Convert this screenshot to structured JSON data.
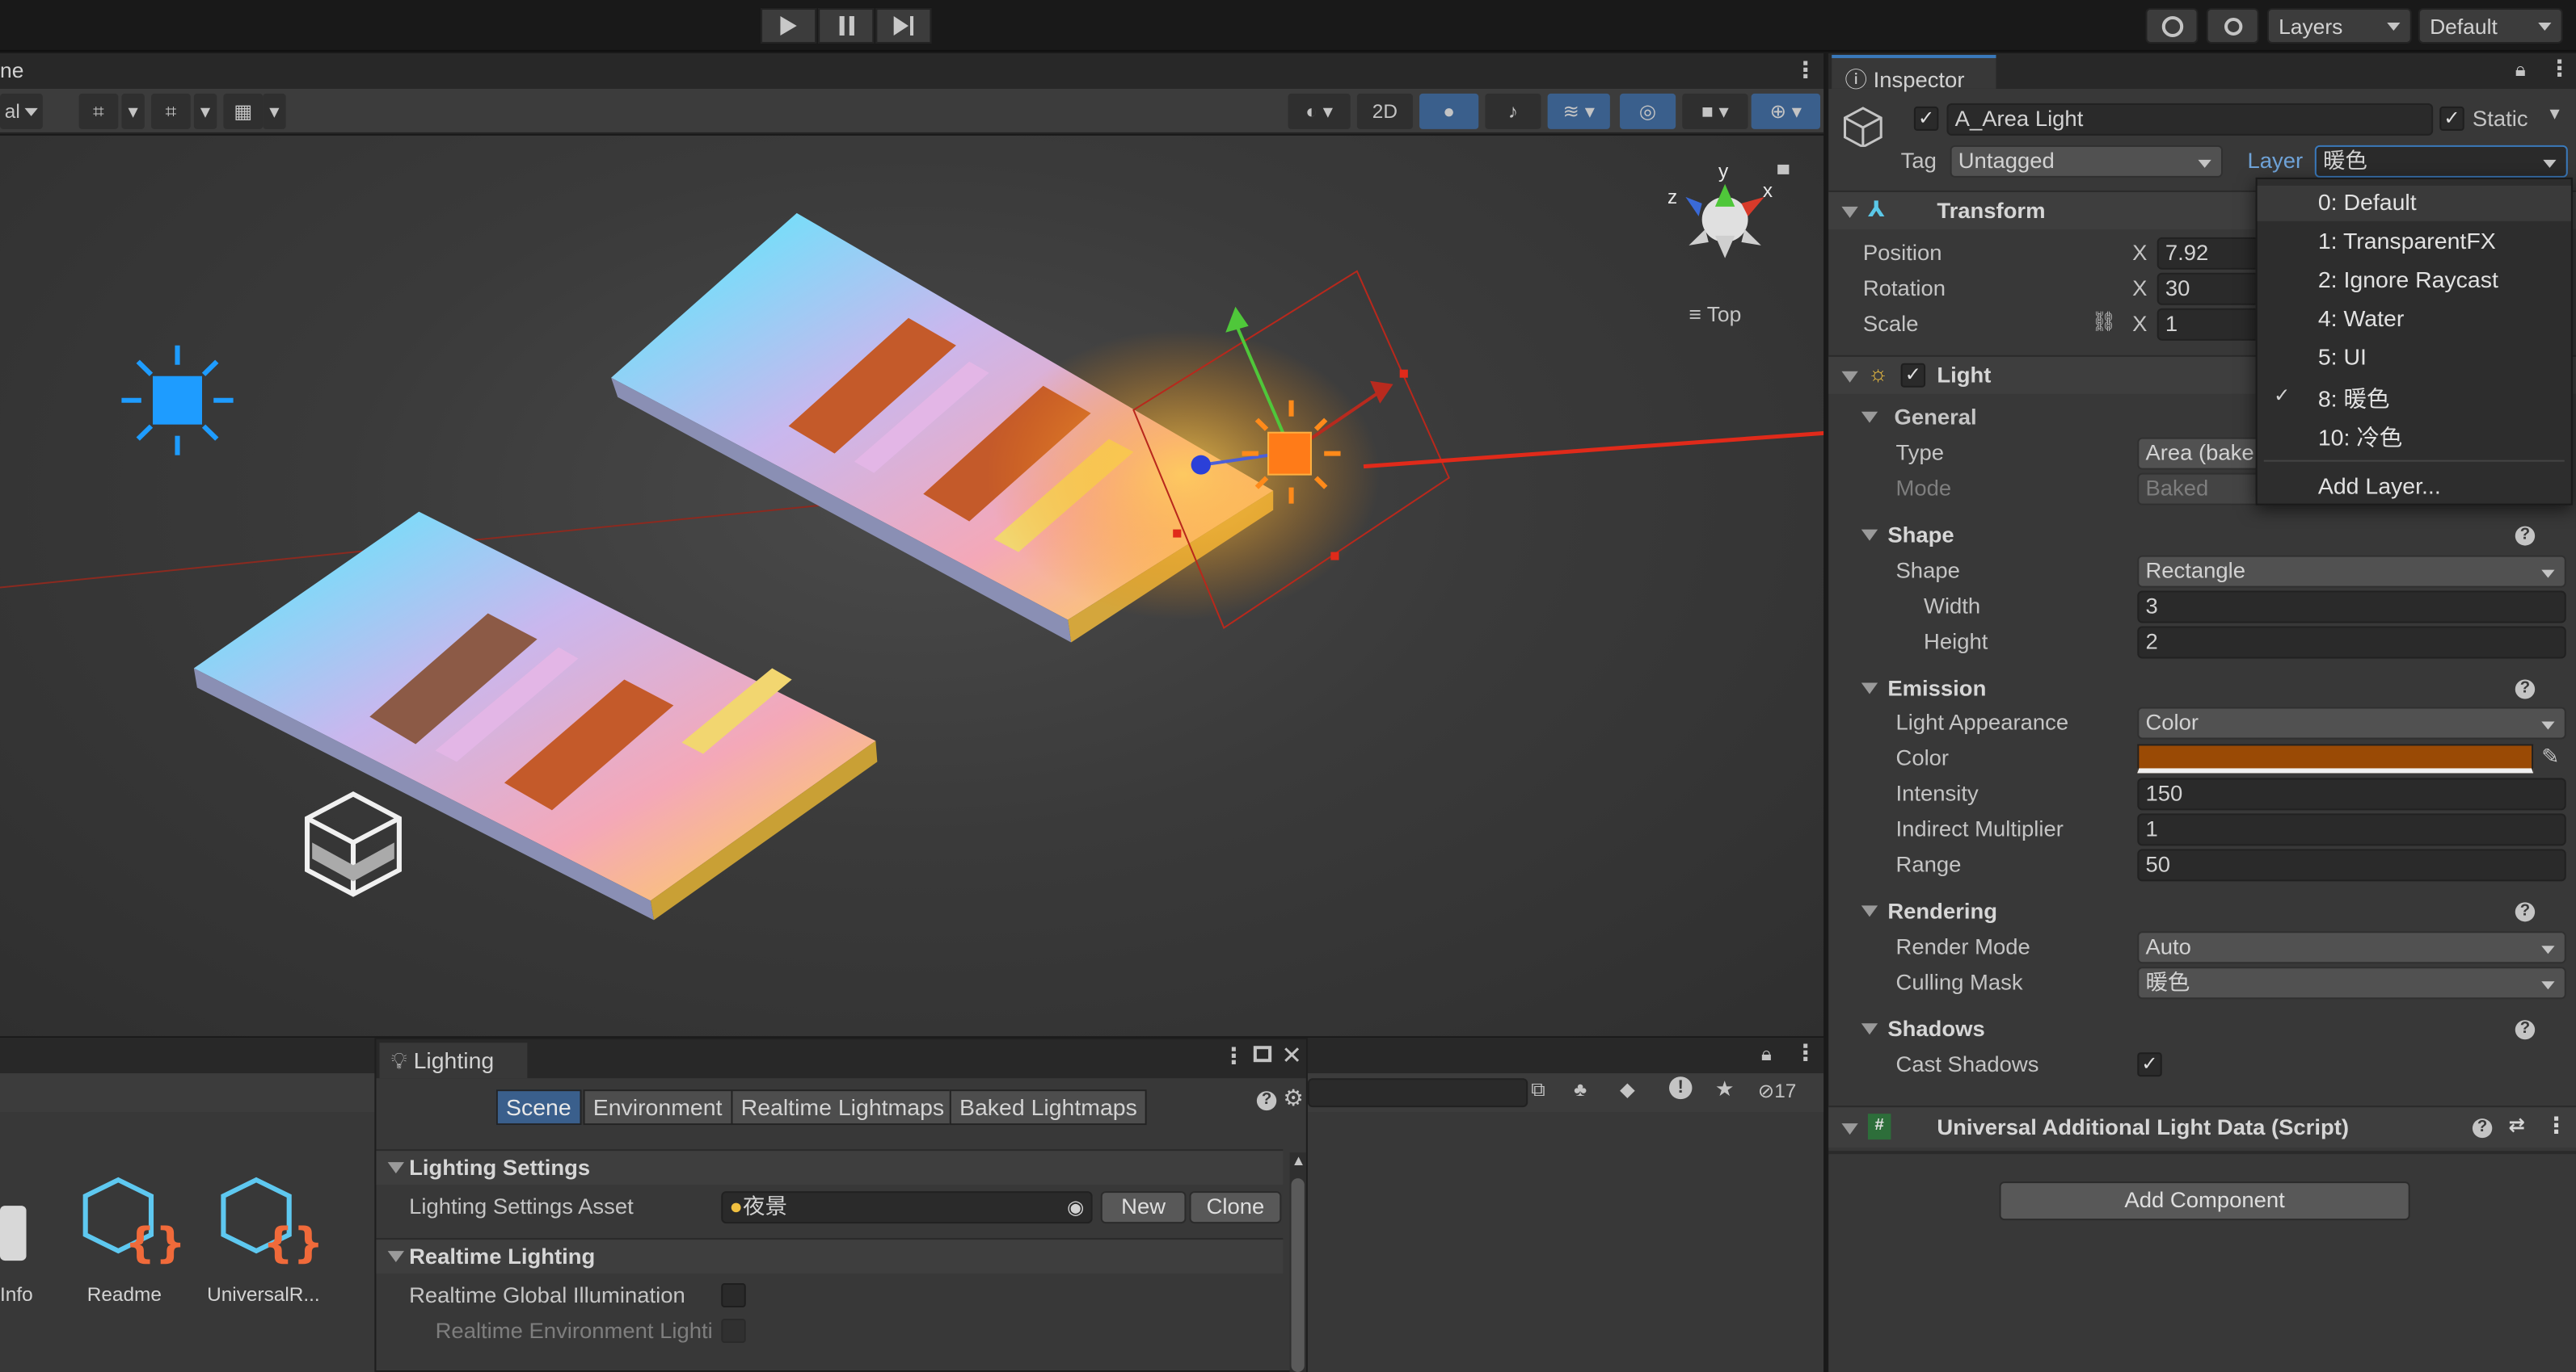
{
  "toolbar": {
    "play_icon": "play-icon",
    "pause_icon": "pause-icon",
    "step_icon": "step-icon",
    "layers_label": "Layers",
    "layout_label": "Default"
  },
  "scene": {
    "tab_label_fragment": "ne",
    "toolbar_left_fragment": "al",
    "view_mode_label": "2D",
    "gizmo_view_label": "Top",
    "gizmo_axes": [
      "y",
      "x",
      "z"
    ]
  },
  "inspector": {
    "tab_label": "Inspector",
    "object_name": "A_Area Light",
    "static_label": "Static",
    "tag_label": "Tag",
    "tag_value": "Untagged",
    "layer_label": "Layer",
    "layer_value": "暖色",
    "transform": {
      "title": "Transform",
      "position_label": "Position",
      "position_x": "7.92",
      "rotation_label": "Rotation",
      "rotation_x": "30",
      "scale_label": "Scale",
      "scale_x": "1",
      "axis_x": "X"
    },
    "light": {
      "title": "Light",
      "general_label": "General",
      "type_label": "Type",
      "type_value": "Area (bake",
      "mode_label": "Mode",
      "mode_value": "Baked"
    },
    "shape": {
      "title": "Shape",
      "shape_label": "Shape",
      "shape_value": "Rectangle",
      "width_label": "Width",
      "width_value": "3",
      "height_label": "Height",
      "height_value": "2"
    },
    "emission": {
      "title": "Emission",
      "appearance_label": "Light Appearance",
      "appearance_value": "Color",
      "color_label": "Color",
      "color_hex": "#9a4a05",
      "intensity_label": "Intensity",
      "intensity_value": "150",
      "indirect_label": "Indirect Multiplier",
      "indirect_value": "1",
      "range_label": "Range",
      "range_value": "50"
    },
    "rendering": {
      "title": "Rendering",
      "render_mode_label": "Render Mode",
      "render_mode_value": "Auto",
      "culling_label": "Culling Mask",
      "culling_value": "暖色"
    },
    "shadows": {
      "title": "Shadows",
      "cast_label": "Cast Shadows"
    },
    "script_component": "Universal Additional Light Data (Script)",
    "add_component": "Add Component"
  },
  "layer_popup": {
    "items": [
      "0: Default",
      "1: TransparentFX",
      "2: Ignore Raycast",
      "4: Water",
      "5: UI",
      "8: 暖色",
      "10: 冷色",
      "Add Layer..."
    ],
    "checked_index": 5
  },
  "lighting_window": {
    "title": "Lighting",
    "tabs": [
      "Scene",
      "Environment",
      "Realtime Lightmaps",
      "Baked Lightmaps"
    ],
    "active_tab": "Scene",
    "settings_section": "Lighting Settings",
    "asset_label": "Lighting Settings Asset",
    "asset_value": "夜景",
    "new_button": "New",
    "clone_button": "Clone",
    "realtime_section": "Realtime Lighting",
    "realtime_gi_label": "Realtime Global Illumination",
    "realtime_env_label": "Realtime Environment Lighti"
  },
  "project": {
    "items": [
      "Info",
      "Readme",
      "UniversalR..."
    ],
    "hidden_count": "17"
  },
  "colors": {
    "accent_blue": "#3a5f8c",
    "layer_link": "#6fa3d8",
    "arrow_red": "#e02a1a"
  }
}
